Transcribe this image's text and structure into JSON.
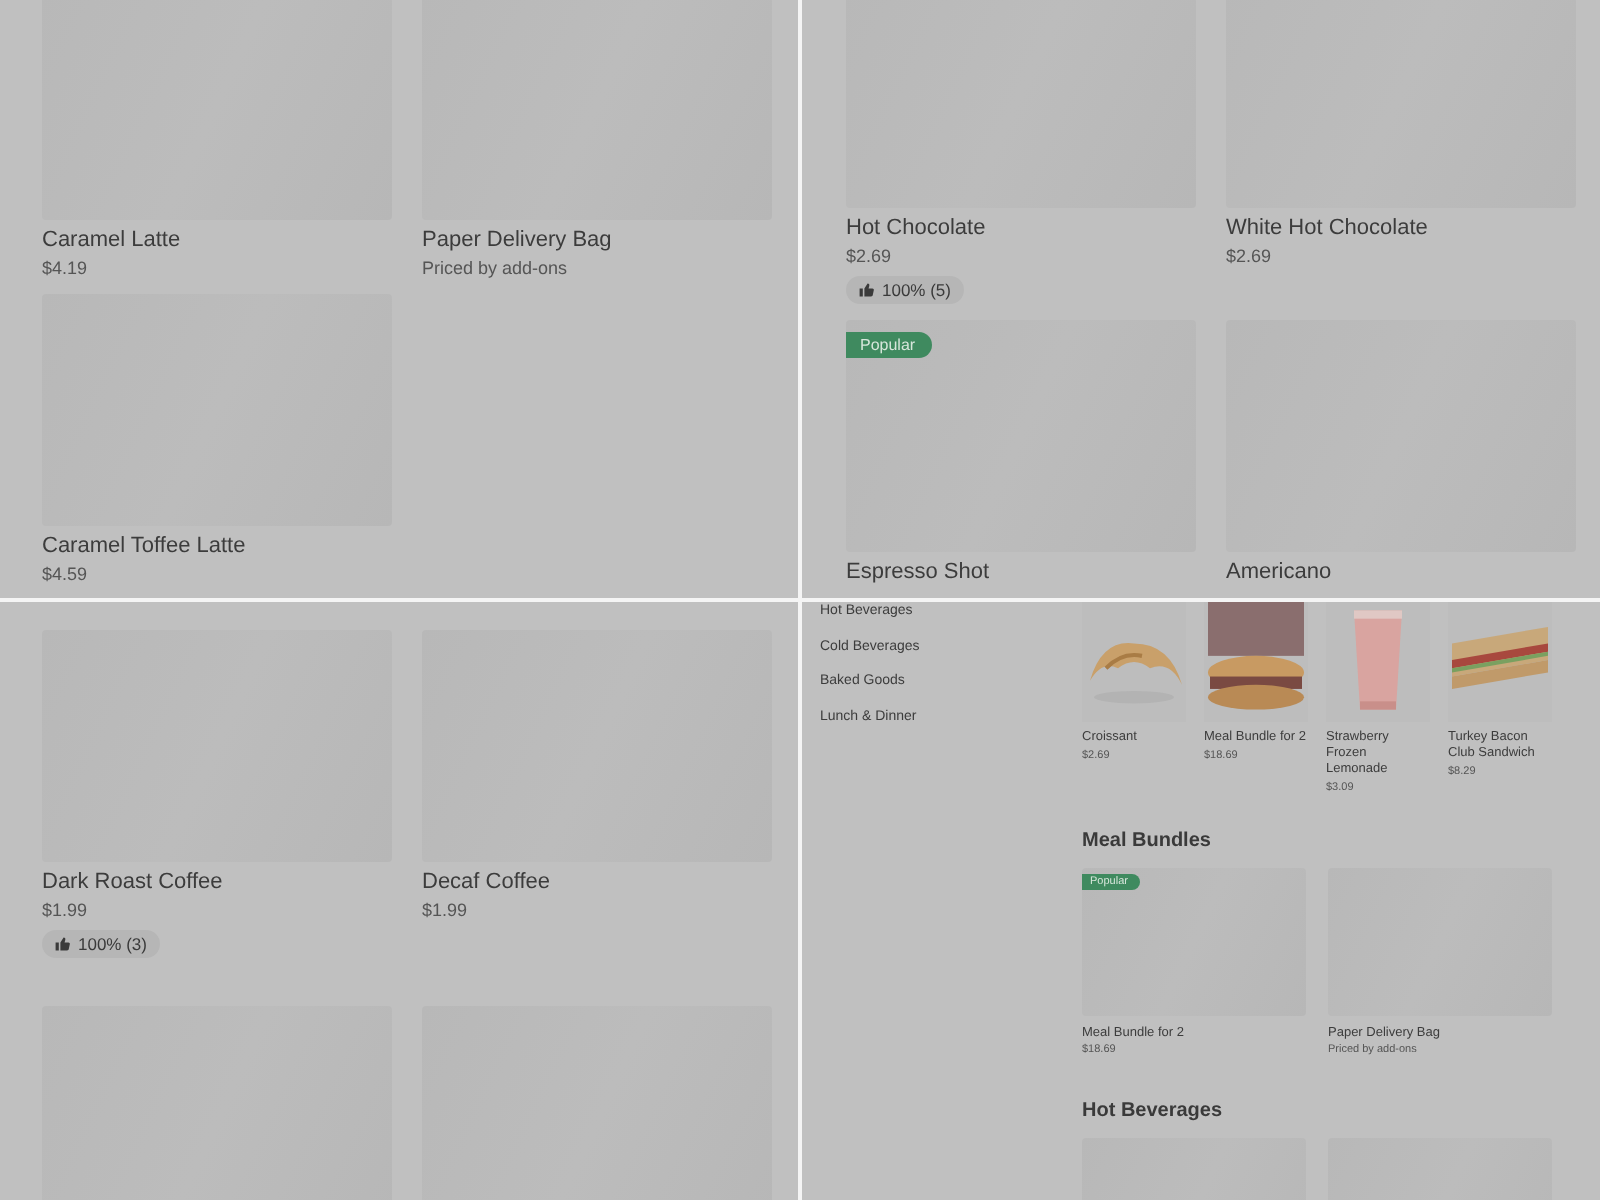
{
  "panels": [
    {
      "kind": "grid",
      "cards": [
        {
          "kind": "card",
          "name": "Caramel Latte",
          "price": "$4.19"
        },
        {
          "kind": "card",
          "name": "Paper Delivery Bag",
          "price": "Priced by add-ons"
        },
        {
          "kind": "card",
          "name": "Caramel Toffee Latte",
          "price": "$4.59"
        }
      ]
    },
    {
      "kind": "grid",
      "cards": [
        {
          "kind": "card",
          "name": "Hot Chocolate",
          "price": "$2.69",
          "rating": "100% (5)"
        },
        {
          "kind": "card",
          "name": "White Hot Chocolate",
          "price": "$2.69"
        },
        {
          "kind": "card",
          "name": "Espresso Shot",
          "badge": "Popular"
        },
        {
          "kind": "card",
          "name": "Americano"
        }
      ]
    },
    {
      "kind": "grid",
      "cards": [
        {
          "kind": "card",
          "name": "Dark Roast Coffee",
          "price": "$1.99",
          "rating": "100% (3)"
        },
        {
          "kind": "card",
          "name": "Decaf Coffee",
          "price": "$1.99"
        },
        {
          "kind": "card"
        },
        {
          "kind": "card"
        }
      ]
    },
    {
      "kind": "menu",
      "categories": [
        "Hot Beverages",
        "Cold Beverages",
        "Baked Goods",
        "Lunch & Dinner"
      ],
      "featured": [
        {
          "name": "Croissant",
          "price": "$2.69"
        },
        {
          "name": "Meal Bundle for 2",
          "price": "$18.69"
        },
        {
          "name": "Strawberry Frozen Lemonade",
          "price": "$3.09"
        },
        {
          "name": "Turkey Bacon Club Sandwich",
          "price": "$8.29"
        }
      ],
      "sections": [
        {
          "title": "Meal Bundles",
          "cards": [
            {
              "kind": "card",
              "name": "Meal Bundle for 2",
              "price": "$18.69",
              "badge": "Popular"
            },
            {
              "kind": "card",
              "name": "Paper Delivery Bag",
              "price": "Priced by add-ons"
            }
          ]
        },
        {
          "title": "Hot Beverages",
          "cards": [
            {
              "kind": "card"
            },
            {
              "kind": "card"
            }
          ]
        }
      ]
    }
  ]
}
